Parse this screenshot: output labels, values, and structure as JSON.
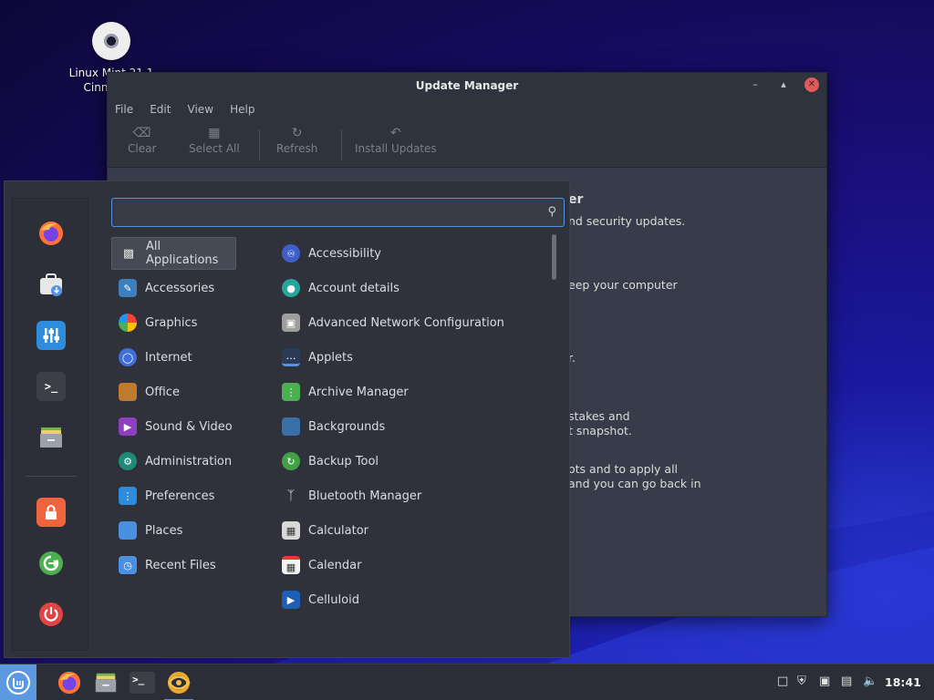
{
  "desktop": {
    "icon_label_line1": "Linux Mint 21.1",
    "icon_label_line2": "Cinnamon"
  },
  "update_manager": {
    "title": "Update Manager",
    "menu": [
      "File",
      "Edit",
      "View",
      "Help"
    ],
    "toolbar": {
      "clear": "Clear",
      "select_all": "Select All",
      "refresh": "Refresh",
      "install_updates": "Install Updates"
    },
    "content": {
      "heading_fragment": "er",
      "line1": "nd security updates.",
      "line2": "eep your computer",
      "line3": "r.",
      "line4": "stakes and",
      "line5": "t snapshot.",
      "line6": "ots and to apply all",
      "line7": "and you can go back in"
    }
  },
  "app_menu": {
    "search": {
      "value": "",
      "placeholder": ""
    },
    "categories": [
      "All Applications",
      "Accessories",
      "Graphics",
      "Internet",
      "Office",
      "Sound & Video",
      "Administration",
      "Preferences",
      "Places",
      "Recent Files"
    ],
    "apps": [
      "Accessibility",
      "Account details",
      "Advanced Network Configuration",
      "Applets",
      "Archive Manager",
      "Backgrounds",
      "Backup Tool",
      "Bluetooth Manager",
      "Calculator",
      "Calendar",
      "Celluloid"
    ]
  },
  "panel": {
    "clock": "18:41"
  },
  "colors": {
    "accent": "#5294e2",
    "menu_bg": "#2f323b",
    "window_bg": "#383c4a",
    "close_button": "#e05a5a"
  }
}
